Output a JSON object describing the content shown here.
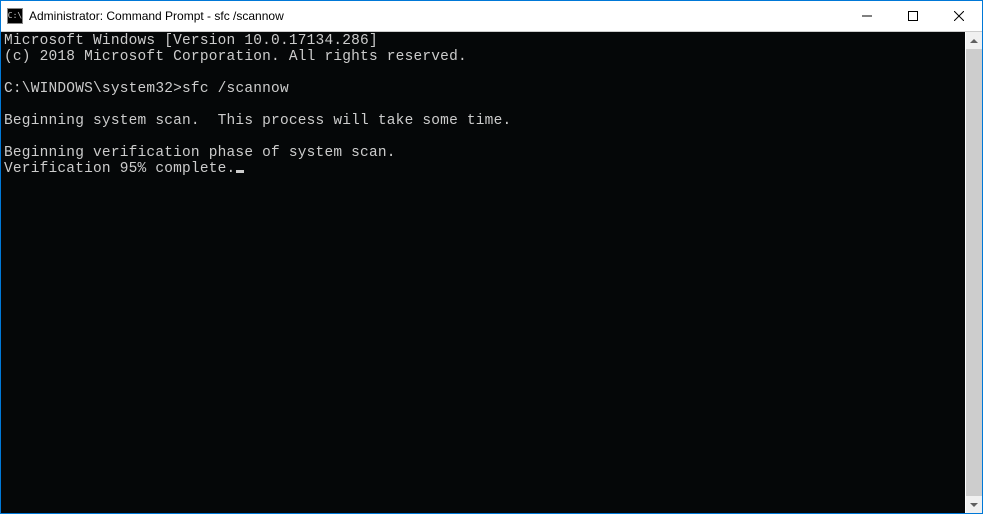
{
  "titlebar": {
    "icon_label": "C:\\",
    "title": "Administrator: Command Prompt - sfc  /scannow"
  },
  "terminal": {
    "line1": "Microsoft Windows [Version 10.0.17134.286]",
    "line2": "(c) 2018 Microsoft Corporation. All rights reserved.",
    "line3": "",
    "prompt": "C:\\WINDOWS\\system32>",
    "command": "sfc /scannow",
    "line5": "",
    "line6": "Beginning system scan.  This process will take some time.",
    "line7": "",
    "line8": "Beginning verification phase of system scan.",
    "line9": "Verification 95% complete."
  }
}
